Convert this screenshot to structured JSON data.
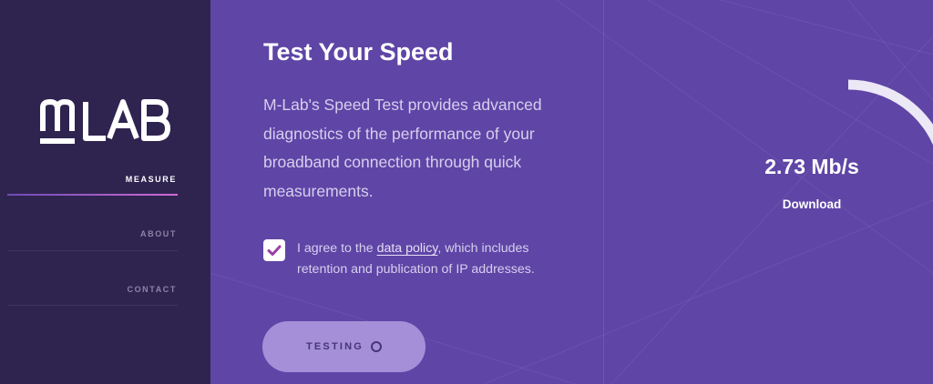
{
  "sidebar": {
    "logo_text": "MLAB",
    "nav": [
      {
        "label": "MEASURE",
        "active": true
      },
      {
        "label": "ABOUT",
        "active": false
      },
      {
        "label": "CONTACT",
        "active": false
      }
    ]
  },
  "main": {
    "title": "Test Your Speed",
    "description": "M-Lab's Speed Test provides advanced diagnostics of the performance of your broadband connection through quick measurements.",
    "consent": {
      "checked": true,
      "text_before": "I agree to the ",
      "link": "data policy",
      "text_after": ", which includes retention and publication of IP addresses."
    },
    "button": {
      "label": "TESTING",
      "icon": "spinner-icon"
    }
  },
  "result": {
    "value": "2.73 Mb/s",
    "label": "Download",
    "gauge_fraction": 0.2
  },
  "colors": {
    "sidebar_bg": "#2f2450",
    "main_bg": "#5f45a6",
    "accent": "#9b3fa8",
    "button_bg": "#a58fd8",
    "gauge": "#ece8f6"
  }
}
